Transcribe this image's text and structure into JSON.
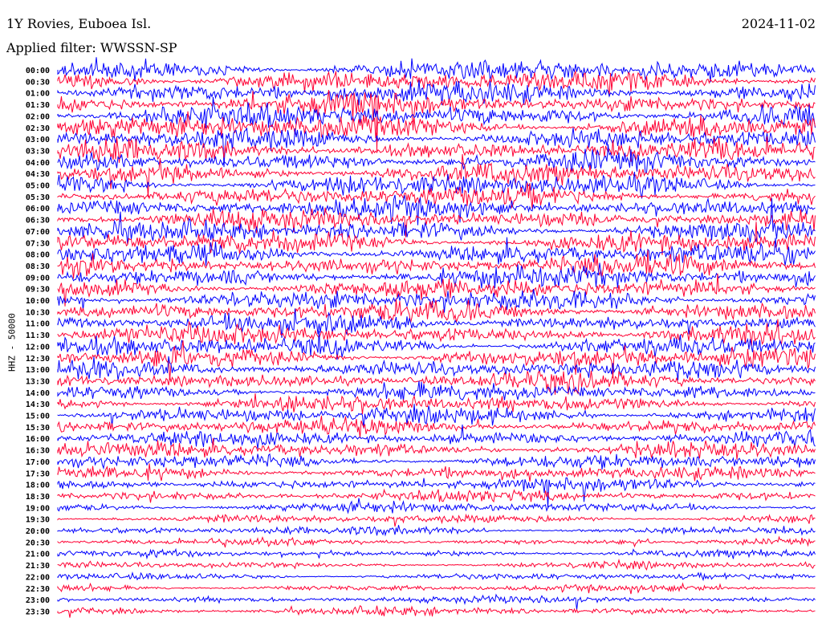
{
  "header": {
    "station": "1Y Rovies, Euboea Isl.",
    "date": "2024-11-02",
    "filter": "Applied filter: WWSSN-SP"
  },
  "chart_data": {
    "type": "line",
    "subtype": "helicorder",
    "ylabel": "HHZ - 50000",
    "row_labels": [
      "00:00",
      "00:30",
      "01:00",
      "01:30",
      "02:00",
      "02:30",
      "03:00",
      "03:30",
      "04:00",
      "04:30",
      "05:00",
      "05:30",
      "06:00",
      "06:30",
      "07:00",
      "07:30",
      "08:00",
      "08:30",
      "09:00",
      "09:30",
      "10:00",
      "10:30",
      "11:00",
      "11:30",
      "12:00",
      "12:30",
      "13:00",
      "13:30",
      "14:00",
      "14:30",
      "15:00",
      "15:30",
      "16:00",
      "16:30",
      "17:00",
      "17:30",
      "18:00",
      "18:30",
      "19:00",
      "19:30",
      "20:00",
      "20:30",
      "21:00",
      "21:30",
      "22:00",
      "22:30",
      "23:00",
      "23:30"
    ],
    "colors": [
      "#0000ff",
      "#ff0033"
    ],
    "amplitude_scale_by_row": [
      3.2,
      3.2,
      3.2,
      3.3,
      3.4,
      3.5,
      3.2,
      3.0,
      3.0,
      3.0,
      3.1,
      3.1,
      3.1,
      3.1,
      3.0,
      3.0,
      3.0,
      3.0,
      3.0,
      3.0,
      3.0,
      2.9,
      2.9,
      2.9,
      2.9,
      2.9,
      2.7,
      2.6,
      2.5,
      2.4,
      2.4,
      2.4,
      2.3,
      2.3,
      2.1,
      2.0,
      1.9,
      1.7,
      1.5,
      1.3,
      1.2,
      1.1,
      1.0,
      1.0,
      1.0,
      1.0,
      1.1,
      1.2
    ]
  }
}
